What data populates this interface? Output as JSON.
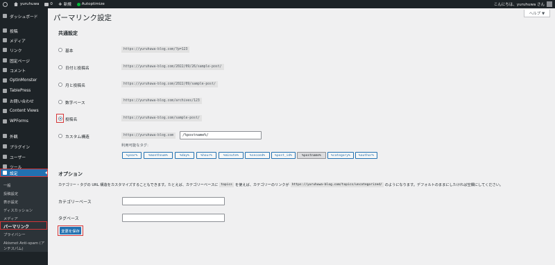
{
  "admin_bar": {
    "site_name": "yuruhuwa",
    "comments_count": "0",
    "new_label": "新規",
    "plugin_label": "Autoptimize",
    "greeting": "こんにちは、yuruhuwa さん"
  },
  "sidebar": {
    "items": [
      {
        "label": "ダッシュボード",
        "icon": "dashboard-icon"
      },
      {
        "label": "投稿",
        "icon": "pin-icon"
      },
      {
        "label": "メディア",
        "icon": "media-icon"
      },
      {
        "label": "リンク",
        "icon": "link-icon"
      },
      {
        "label": "固定ページ",
        "icon": "page-icon"
      },
      {
        "label": "コメント",
        "icon": "comment-icon"
      },
      {
        "label": "OptinMonster",
        "icon": "optinmonster-icon"
      },
      {
        "label": "TablePress",
        "icon": "table-icon"
      },
      {
        "label": "お問い合わせ",
        "icon": "mail-icon"
      },
      {
        "label": "Content Views",
        "icon": "views-icon"
      },
      {
        "label": "WPForms",
        "icon": "forms-icon"
      },
      {
        "label": "外観",
        "icon": "appearance-icon"
      },
      {
        "label": "プラグイン",
        "icon": "plugin-icon"
      },
      {
        "label": "ユーザー",
        "icon": "user-icon"
      },
      {
        "label": "ツール",
        "icon": "wrench-icon"
      },
      {
        "label": "設定",
        "icon": "settings-icon"
      }
    ],
    "submenu": [
      {
        "label": "一般"
      },
      {
        "label": "投稿設定"
      },
      {
        "label": "表示設定"
      },
      {
        "label": "ディスカッション"
      },
      {
        "label": "メディア"
      },
      {
        "label": "パーマリンク"
      },
      {
        "label": "プライバシー"
      },
      {
        "label": "Akismet Anti-spam (ア"
      },
      {
        "label": "ンチスパム)"
      }
    ]
  },
  "help_tab": "ヘルプ ▼",
  "page_title": "パーマリンク設定",
  "common_settings": {
    "title": "共通設定",
    "options": [
      {
        "label": "基本",
        "example": "https://yuruhuwa-blog.com/?p=123",
        "checked": false
      },
      {
        "label": "日付と投稿名",
        "example": "https://yuruhuwa-blog.com/2022/09/26/sample-post/",
        "checked": false
      },
      {
        "label": "月と投稿名",
        "example": "https://yuruhuwa-blog.com/2022/09/sample-post/",
        "checked": false
      },
      {
        "label": "数字ベース",
        "example": "https://yuruhuwa-blog.com/archives/123",
        "checked": false
      },
      {
        "label": "投稿名",
        "example": "https://yuruhuwa-blog.com/sample-post/",
        "checked": true
      }
    ],
    "custom": {
      "label": "カスタム構造",
      "prefix": "https://yuruhuwa-blog.com",
      "value": "/%postname%/"
    },
    "tags_label": "利用可能なタグ:",
    "tags": [
      {
        "label": "%year%",
        "active": false
      },
      {
        "label": "%monthnum%",
        "active": false
      },
      {
        "label": "%day%",
        "active": false
      },
      {
        "label": "%hour%",
        "active": false
      },
      {
        "label": "%minute%",
        "active": false
      },
      {
        "label": "%second%",
        "active": false
      },
      {
        "label": "%post_id%",
        "active": false
      },
      {
        "label": "%postname%",
        "active": true
      },
      {
        "label": "%category%",
        "active": false
      },
      {
        "label": "%author%",
        "active": false
      }
    ]
  },
  "optional": {
    "title": "オプション",
    "desc_1": "カテゴリー・タグの URL 構造をカスタマイズすることもできます。たとえば、カテゴリーベースに",
    "desc_code_1": "topics",
    "desc_2": "を使えば、カテゴリーのリンクが",
    "desc_code_2": "https://yuruhuwa-blog.com/topics/uncategorized/",
    "desc_3": "のようになります。デフォルトのままにしたければ空欄にしてください。",
    "category_base_label": "カテゴリーベース",
    "category_base_value": "",
    "tag_base_label": "タグベース",
    "tag_base_value": ""
  },
  "save_button": "変更を保存"
}
